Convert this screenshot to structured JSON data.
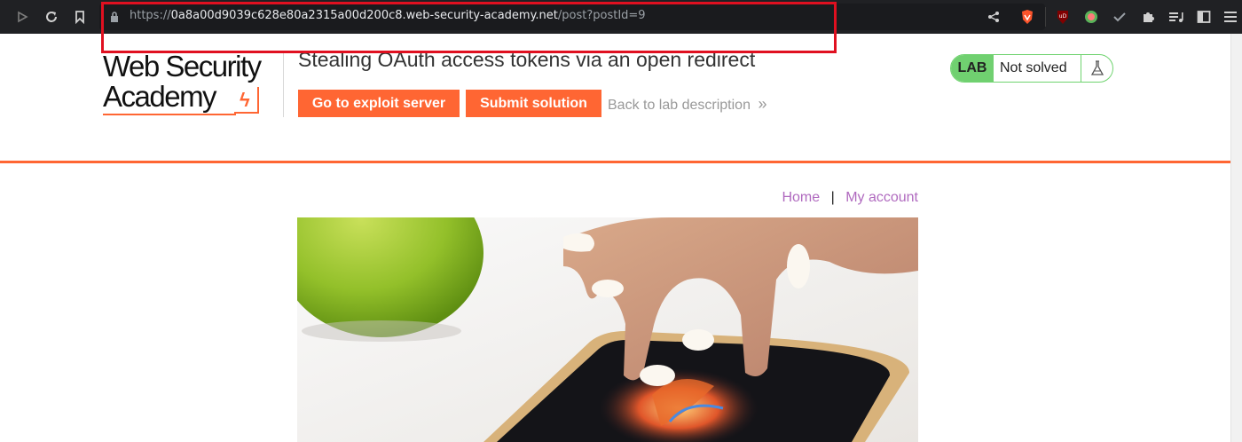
{
  "browser": {
    "url_prefix": "https://",
    "url_host": "0a8a00d9039c628e80a2315a00d200c8.web-security-academy.net",
    "url_path": "/post?postId=9",
    "icons": [
      "play-icon",
      "reload-icon",
      "bookmark-icon",
      "lock-icon",
      "share-icon",
      "brave-shield-icon",
      "ublock-icon",
      "extension-dot-icon",
      "check-icon",
      "puzzle-icon",
      "playlist-icon",
      "sidebar-icon",
      "menu-icon"
    ]
  },
  "header": {
    "logo_line1": "Web Security",
    "logo_line2": "Academy",
    "lab_title": "Stealing OAuth access tokens via an open redirect",
    "exploit_button": "Go to exploit server",
    "submit_button": "Submit solution",
    "back_link": "Back to lab description",
    "back_chevrons": "»",
    "lab_label": "LAB",
    "lab_status": "Not solved",
    "colors": {
      "accent": "#ff6633",
      "solved_green": "#70d070",
      "link": "#b06abf"
    }
  },
  "nav": {
    "home": "Home",
    "separator": "|",
    "my_account": "My account"
  }
}
